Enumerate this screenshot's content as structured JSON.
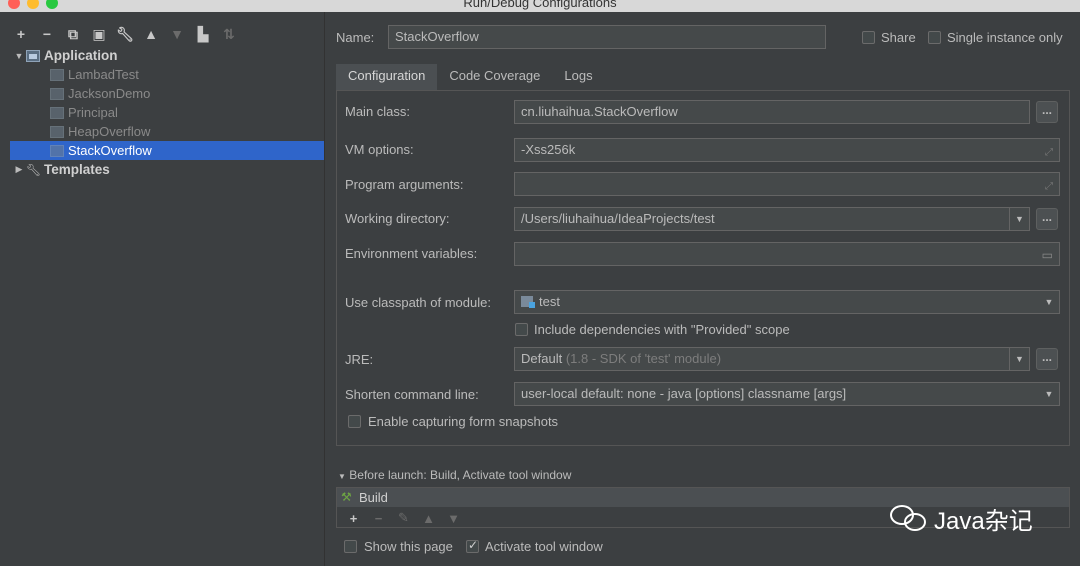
{
  "window": {
    "title": "Run/Debug Configurations"
  },
  "toolbar": {
    "add": "+",
    "remove": "−",
    "copy": "⧉",
    "save": "▣",
    "edit": "🔧",
    "up": "▲",
    "down": "▼",
    "folder": "▙",
    "sort": "⇅"
  },
  "tree": {
    "application": {
      "label": "Application",
      "expanded": true
    },
    "children": [
      {
        "label": "LambadTest"
      },
      {
        "label": "JacksonDemo"
      },
      {
        "label": "Principal"
      },
      {
        "label": "HeapOverflow"
      },
      {
        "label": "StackOverflow",
        "selected": true
      }
    ],
    "templates": {
      "label": "Templates",
      "expanded": false
    }
  },
  "header": {
    "name_label": "Name:",
    "name_value": "StackOverflow",
    "share_label": "Share",
    "share_checked": false,
    "single_instance_label": "Single instance only",
    "single_instance_checked": false
  },
  "tabs": [
    {
      "label": "Configuration",
      "active": true
    },
    {
      "label": "Code Coverage",
      "active": false
    },
    {
      "label": "Logs",
      "active": false
    }
  ],
  "config": {
    "main_class_label": "Main class:",
    "main_class_value": "cn.liuhaihua.StackOverflow",
    "vm_options_label": "VM options:",
    "vm_options_value": "-Xss256k",
    "program_args_label": "Program arguments:",
    "program_args_value": "",
    "working_dir_label": "Working directory:",
    "working_dir_value": "/Users/liuhaihua/IdeaProjects/test",
    "env_vars_label": "Environment variables:",
    "env_vars_value": "",
    "classpath_label": "Use classpath of module:",
    "classpath_value": "test",
    "include_deps_label": "Include dependencies with \"Provided\" scope",
    "include_deps_checked": false,
    "jre_label": "JRE:",
    "jre_value": "Default",
    "jre_hint": "(1.8 - SDK of 'test' module)",
    "shorten_label": "Shorten command line:",
    "shorten_value": "user-local default: none - java [options] classname [args]",
    "capture_label": "Enable capturing form snapshots",
    "capture_checked": false,
    "browse": "..."
  },
  "before_launch": {
    "header": "Before launch: Build, Activate tool window",
    "items": [
      {
        "label": "Build"
      }
    ]
  },
  "footer": {
    "show_page_label": "Show this page",
    "show_page_checked": false,
    "activate_label": "Activate tool window",
    "activate_checked": true
  },
  "watermark": {
    "text": "Java杂记"
  }
}
